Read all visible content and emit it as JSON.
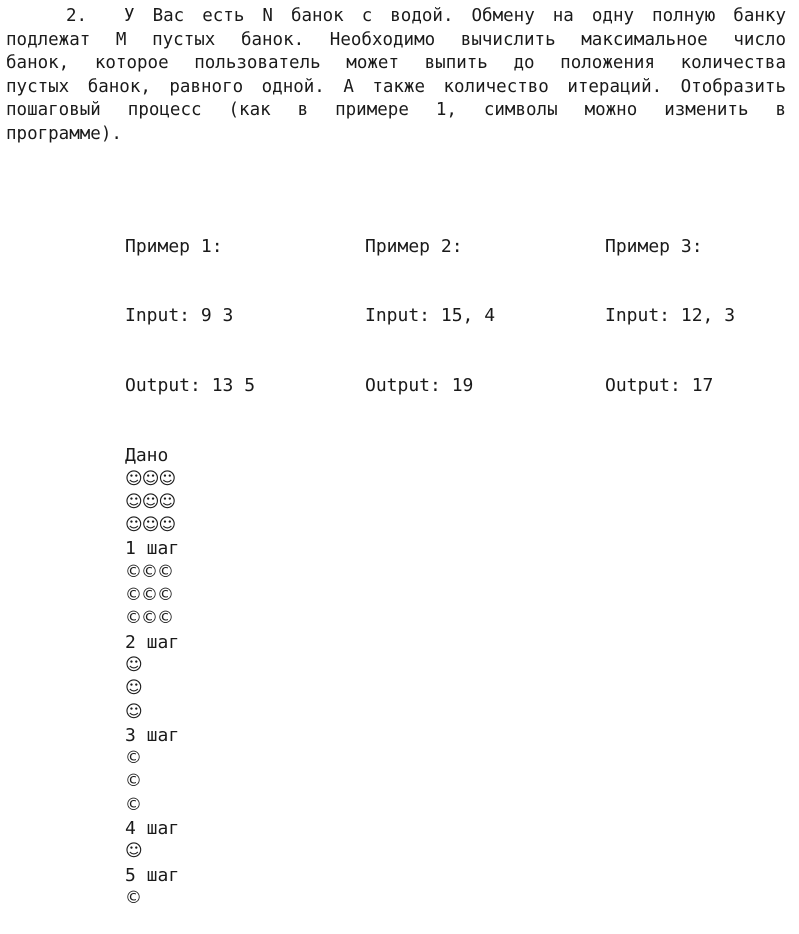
{
  "task": {
    "number": "2.",
    "lines": [
      "У Вас есть N банок с водой. Обмену на одну полную банку",
      "подлежат M пустых банок. Необходимо вычислить максимальное число",
      "банок, которое пользователь может выпить до положения количества",
      "пустых банок, равного одной. А также количество итераций. Отобразить",
      "пошаговый процесс (как в примере 1, символы можно изменить в",
      "программе)."
    ]
  },
  "examples": [
    {
      "title": "Пример 1:",
      "input": "Input: 9 3",
      "output": "Output: 13 5",
      "process": [
        {
          "text": "Дано",
          "kind": "label"
        },
        {
          "text": "☺☺☺",
          "kind": "sym"
        },
        {
          "text": "☺☺☺",
          "kind": "sym"
        },
        {
          "text": "☺☺☺",
          "kind": "sym"
        },
        {
          "text": "1 шаг",
          "kind": "label"
        },
        {
          "text": "©©©",
          "kind": "sym"
        },
        {
          "text": "©©©",
          "kind": "sym"
        },
        {
          "text": "©©©",
          "kind": "sym"
        },
        {
          "text": "2 шаг",
          "kind": "label"
        },
        {
          "text": "☺",
          "kind": "sym"
        },
        {
          "text": "☺",
          "kind": "sym"
        },
        {
          "text": "☺",
          "kind": "sym"
        },
        {
          "text": "3 шаг",
          "kind": "label"
        },
        {
          "text": "©",
          "kind": "sym"
        },
        {
          "text": "©",
          "kind": "sym"
        },
        {
          "text": "©",
          "kind": "sym"
        },
        {
          "text": "4 шаг",
          "kind": "label"
        },
        {
          "text": "☺",
          "kind": "sym"
        },
        {
          "text": "5 шаг",
          "kind": "label"
        },
        {
          "text": "©",
          "kind": "sym"
        }
      ]
    },
    {
      "title": "Пример 2:",
      "input": "Input: 15, 4",
      "output": "Output: 19",
      "process": []
    },
    {
      "title": "Пример 3:",
      "input": "Input: 12, 3",
      "output": "Output: 17",
      "process": []
    }
  ]
}
